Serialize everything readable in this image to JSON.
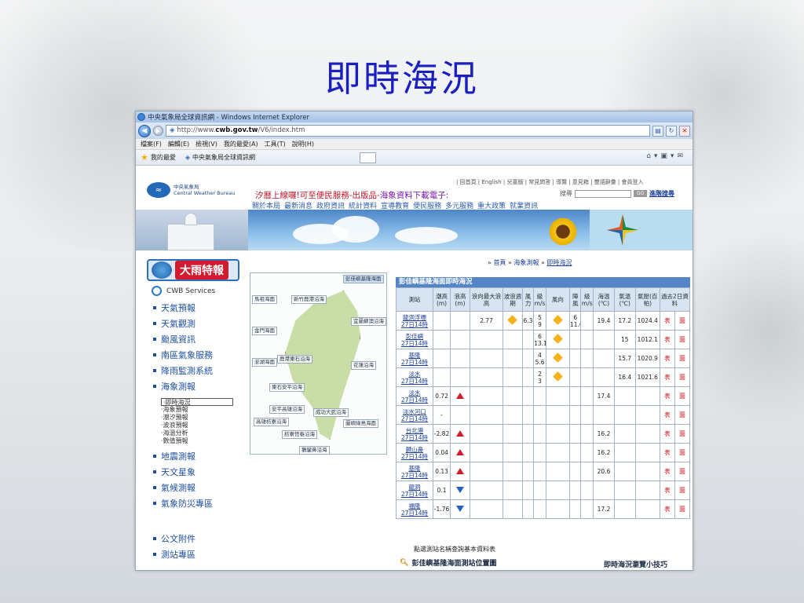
{
  "slide": {
    "title": "即時海況"
  },
  "browser": {
    "window_title": "中央氣象局全球資訊網 - Windows Internet Explorer",
    "address_prefix": "http://www.",
    "address_host": "cwb.gov.tw",
    "address_path": "/V6/index.htm",
    "menu": [
      "檔案(F)",
      "編輯(E)",
      "檢視(V)",
      "我的最愛(A)",
      "工具(T)",
      "說明(H)"
    ],
    "favorites_label": "我的最愛",
    "tab_title": "中央氣象局全球資訊網"
  },
  "site": {
    "logo_cn": "中央氣象局",
    "logo_en": "Central Weather Bureau",
    "top_links": "| 回首頁 | English | 兒童版 | 常見問答 | 導覽 | 意見箱 | 雙語辭彙 | 會員登入",
    "marquee_prefix": "汐暦上線囉!可至便民服務-出版品-",
    "marquee_rest": "海象資料下載電子:",
    "search_label": "搜尋",
    "search_go": "GO",
    "search_advanced": "進階搜尋",
    "nav": [
      "關於本局",
      "最新消息",
      "政府資訊",
      "統計資料",
      "宣導教育",
      "便民服務",
      "多元服務",
      "重大政策",
      "就業資訊"
    ]
  },
  "sidebar": {
    "banner": "大雨特報",
    "services": "CWB Services",
    "items": [
      "天氣預報",
      "天氣觀測",
      "颱風資訊",
      "南區氣象服務",
      "降雨監測系統",
      "海象測報"
    ],
    "sub_items": [
      "‧即時海況",
      "‧海象預報",
      "‧潮汐預報",
      "‧波浪預報",
      "‧海溫分析",
      "‧數值預報"
    ],
    "items_after": [
      "地震測報",
      "天文星象",
      "氣候測報",
      "氣象防災專區"
    ],
    "items_bottom": [
      "公文附件",
      "測站專區"
    ]
  },
  "breadcrumb": {
    "home": "首頁",
    "section": "海象測報",
    "current": "即時海況"
  },
  "map": {
    "labels": [
      "彭佳嶼基隆海面",
      "馬祖海面",
      "新竹鹿港沿海",
      "宜蘭蘇澳沿海",
      "金門海面",
      "澎湖海面",
      "鹿港東石沿海",
      "花蓮沿海",
      "東石安平沿海",
      "安平高雄沿海",
      "成功大武沿海",
      "高雄枋寮沿海",
      "蘭嶼綠島海面",
      "枋寮恆春沿海",
      "鵝鑾鼻沿海"
    ]
  },
  "table": {
    "title": "彭佳嶼基隆海面即時海況",
    "headers": [
      "測站",
      "潮高(m)",
      "浪高(m)",
      "浪向最大浪高",
      "波浪週期",
      "風力",
      "級m/s",
      "風向",
      "陣風",
      "級m/s",
      "海溫(℃)",
      "氣溫(℃)",
      "氣壓(百帕)",
      "過去2日資料"
    ],
    "rows": [
      {
        "station": "龍洞浮標",
        "time": "27日14時",
        "tide": "",
        "wave": "2.77",
        "dir": "wind",
        "period": "6.3",
        "force": "5",
        "force_ms": "9",
        "wind": "wind",
        "gust": "6",
        "gust_ms": "11.6",
        "sea": "19.4",
        "air": "17.2",
        "press": "1024.4",
        "t": "表",
        "g": "圖"
      },
      {
        "station": "彭佳嶼",
        "time": "27日14時",
        "tide": "",
        "wave": "",
        "dir": "",
        "period": "",
        "force": "6",
        "force_ms": "13.1",
        "wind": "wind",
        "gust": "",
        "gust_ms": "",
        "sea": "",
        "air": "15",
        "press": "1012.1",
        "t": "表",
        "g": "圖"
      },
      {
        "station": "基隆",
        "time": "27日14時",
        "tide": "",
        "wave": "",
        "dir": "",
        "period": "",
        "force": "4",
        "force_ms": "5.6",
        "wind": "wind",
        "gust": "",
        "gust_ms": "",
        "sea": "",
        "air": "15.7",
        "press": "1020.9",
        "t": "表",
        "g": "圖"
      },
      {
        "station": "淡水",
        "time": "27日14時",
        "tide": "",
        "wave": "",
        "dir": "",
        "period": "",
        "force": "2",
        "force_ms": "3",
        "wind": "wind",
        "gust": "",
        "gust_ms": "",
        "sea": "",
        "air": "16.4",
        "press": "1021.6",
        "t": "表",
        "g": "圖"
      },
      {
        "station": "淡水",
        "time": "27日14時",
        "tide": "0.72",
        "tide_dir": "up",
        "wave": "",
        "dir": "",
        "period": "",
        "force": "",
        "force_ms": "",
        "wind": "",
        "gust": "",
        "gust_ms": "",
        "sea": "17.4",
        "air": "",
        "press": "",
        "t": "表",
        "g": "圖"
      },
      {
        "station": "淡水河口",
        "time": "27日14時",
        "tide": "-",
        "wave": "",
        "dir": "",
        "period": "",
        "force": "",
        "force_ms": "",
        "wind": "",
        "gust": "",
        "gust_ms": "",
        "sea": "",
        "air": "",
        "press": "",
        "t": "表",
        "g": "圖"
      },
      {
        "station": "台北港",
        "time": "27日14時",
        "tide": "-2.82",
        "tide_dir": "up",
        "wave": "",
        "dir": "",
        "period": "",
        "force": "",
        "force_ms": "",
        "wind": "",
        "gust": "",
        "gust_ms": "",
        "sea": "16.2",
        "air": "",
        "press": "",
        "t": "表",
        "g": "圖"
      },
      {
        "station": "麟山鼻",
        "time": "27日14時",
        "tide": "0.04",
        "tide_dir": "up",
        "wave": "",
        "dir": "",
        "period": "",
        "force": "",
        "force_ms": "",
        "wind": "",
        "gust": "",
        "gust_ms": "",
        "sea": "16.2",
        "air": "",
        "press": "",
        "t": "表",
        "g": "圖"
      },
      {
        "station": "基隆",
        "time": "27日14時",
        "tide": "0.13",
        "tide_dir": "up",
        "wave": "",
        "dir": "",
        "period": "",
        "force": "",
        "force_ms": "",
        "wind": "",
        "gust": "",
        "gust_ms": "",
        "sea": "20.6",
        "air": "",
        "press": "",
        "t": "表",
        "g": "圖"
      },
      {
        "station": "龍洞",
        "time": "27日14時",
        "tide": "0.1",
        "tide_dir": "down",
        "wave": "",
        "dir": "",
        "period": "",
        "force": "",
        "force_ms": "",
        "wind": "",
        "gust": "",
        "gust_ms": "",
        "sea": "",
        "air": "",
        "press": "",
        "t": "表",
        "g": "圖"
      },
      {
        "station": "福隆",
        "time": "27日14時",
        "tide": "-1.76",
        "tide_dir": "down",
        "wave": "",
        "dir": "",
        "period": "",
        "force": "",
        "force_ms": "",
        "wind": "",
        "gust": "",
        "gust_ms": "",
        "sea": "17.2",
        "air": "",
        "press": "",
        "t": "表",
        "g": "圖"
      }
    ]
  },
  "footer": {
    "note": "點選測站名稱查詢基本資料表",
    "map_link": "彭佳嶼基隆海面測站位置圖",
    "tip": "即時海況瀏覽小技巧"
  },
  "colors": {
    "title": "#1a1fc0",
    "table_header": "#5486c7",
    "accent_red": "#d21b2e"
  }
}
